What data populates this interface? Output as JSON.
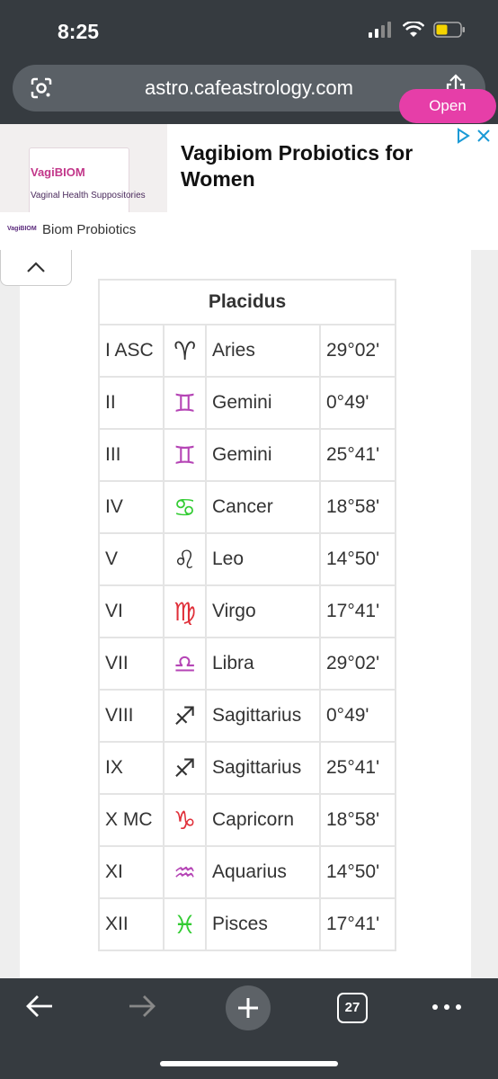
{
  "status": {
    "time": "8:25"
  },
  "browser": {
    "url": "astro.cafeastrology.com",
    "tab_count": "27"
  },
  "ad": {
    "title": "Vagibiom Probiotics for Women",
    "brand": "Biom Probiotics",
    "open_label": "Open",
    "product_logo": "VagiBIOM",
    "product_subtitle": "Vaginal Health Suppositories",
    "accent_color": "#e63ea8"
  },
  "table": {
    "title": "Placidus",
    "rows": [
      {
        "house": "I ASC",
        "glyph": "♈",
        "glyph_color": "#333333",
        "sign": "Aries",
        "degree": "29°02'"
      },
      {
        "house": "II",
        "glyph": "♊",
        "glyph_color": "#b544b5",
        "sign": "Gemini",
        "degree": "0°49'"
      },
      {
        "house": "III",
        "glyph": "♊",
        "glyph_color": "#b544b5",
        "sign": "Gemini",
        "degree": "25°41'"
      },
      {
        "house": "IV",
        "glyph": "♋",
        "glyph_color": "#33cc33",
        "sign": "Cancer",
        "degree": "18°58'"
      },
      {
        "house": "V",
        "glyph": "♌",
        "glyph_color": "#333333",
        "sign": "Leo",
        "degree": "14°50'"
      },
      {
        "house": "VI",
        "glyph": "♍",
        "glyph_color": "#e0303a",
        "sign": "Virgo",
        "degree": "17°41'"
      },
      {
        "house": "VII",
        "glyph": "♎",
        "glyph_color": "#b544b5",
        "sign": "Libra",
        "degree": "29°02'"
      },
      {
        "house": "VIII",
        "glyph": "♐",
        "glyph_color": "#333333",
        "sign": "Sagittarius",
        "degree": "0°49'"
      },
      {
        "house": "IX",
        "glyph": "♐",
        "glyph_color": "#333333",
        "sign": "Sagittarius",
        "degree": "25°41'"
      },
      {
        "house": "X MC",
        "glyph": "♑",
        "glyph_color": "#e0303a",
        "sign": "Capricorn",
        "degree": "18°58'"
      },
      {
        "house": "XI",
        "glyph": "♒",
        "glyph_color": "#b544b5",
        "sign": "Aquarius",
        "degree": "14°50'"
      },
      {
        "house": "XII",
        "glyph": "♓",
        "glyph_color": "#33cc33",
        "sign": "Pisces",
        "degree": "17°41'"
      }
    ]
  }
}
